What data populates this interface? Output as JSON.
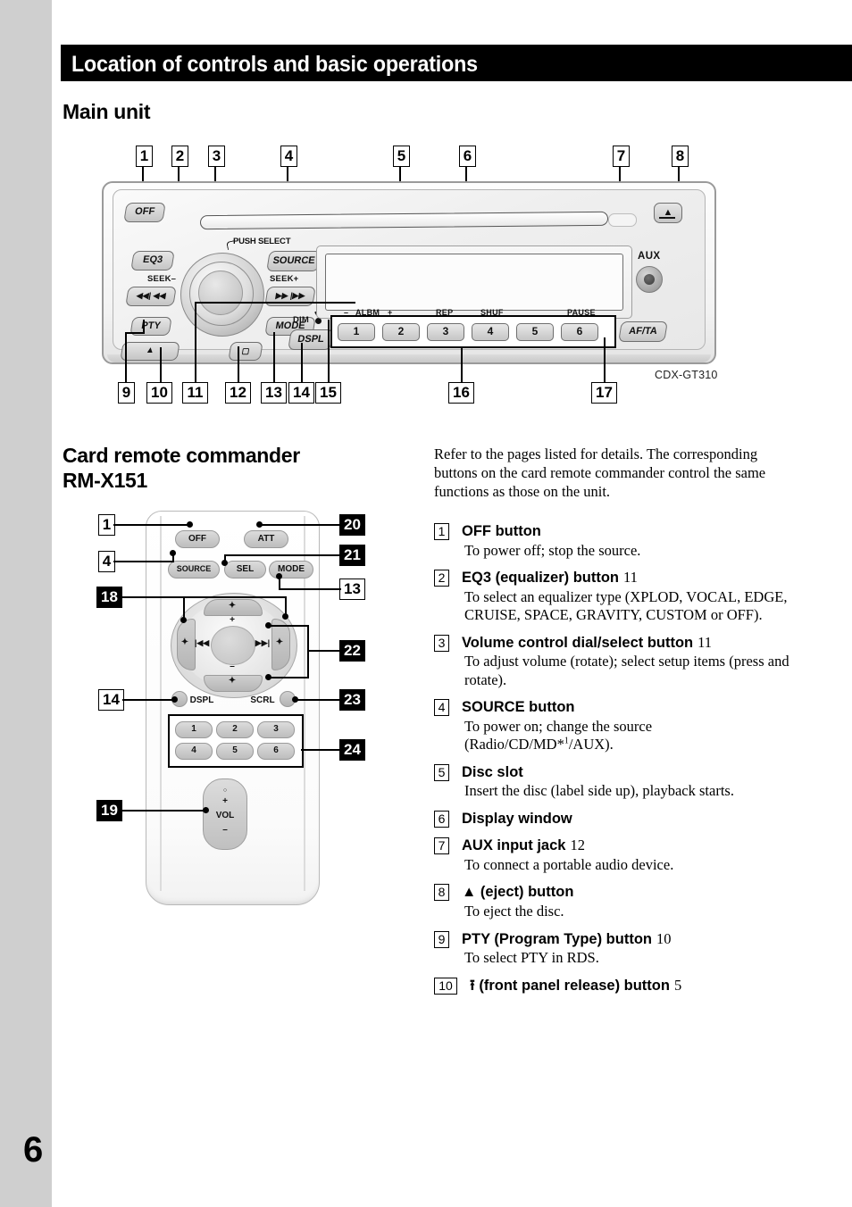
{
  "page": {
    "number": "6"
  },
  "header": {
    "title": "Location of controls and basic operations"
  },
  "sections": {
    "main_unit_title": "Main unit",
    "remote_title": "Card remote commander RM-X151",
    "model_label": "CDX-GT310"
  },
  "main_unit": {
    "callouts_top": [
      "1",
      "2",
      "3",
      "4",
      "5",
      "6",
      "7",
      "8"
    ],
    "callouts_bottom": [
      "9",
      "10",
      "11",
      "12",
      "13",
      "14",
      "15",
      "16",
      "17"
    ],
    "keys": {
      "off": "OFF",
      "eq3": "EQ3",
      "source": "SOURCE",
      "push_select": "PUSH SELECT",
      "seek_minus": "SEEK–",
      "seek_plus": "SEEK+",
      "seek_back_glyph": "◀◀| ◀◀",
      "seek_fwd_glyph": "▶▶ |▶▶",
      "pty": "PTY",
      "eject_front_glyph": "▲",
      "mode": "MODE",
      "dspl": "DSPL",
      "dim": "DIM",
      "eject_top_glyph": "▲",
      "af_ta": "AF/TA",
      "aux": "AUX"
    },
    "preset_labels": {
      "albm_minus": "–",
      "albm": "ALBM",
      "albm_plus": "+",
      "rep": "REP",
      "shuf": "SHUF",
      "pause": "PAUSE"
    },
    "preset_buttons": [
      "1",
      "2",
      "3",
      "4",
      "5",
      "6"
    ]
  },
  "remote": {
    "callouts": [
      {
        "n": "1",
        "inverted": false
      },
      {
        "n": "4",
        "inverted": false
      },
      {
        "n": "18",
        "inverted": true
      },
      {
        "n": "14",
        "inverted": false
      },
      {
        "n": "19",
        "inverted": true
      },
      {
        "n": "20",
        "inverted": true
      },
      {
        "n": "21",
        "inverted": true
      },
      {
        "n": "13",
        "inverted": false
      },
      {
        "n": "22",
        "inverted": true
      },
      {
        "n": "23",
        "inverted": true
      },
      {
        "n": "24",
        "inverted": true
      }
    ],
    "keys": {
      "off": "OFF",
      "att": "ATT",
      "source": "SOURCE",
      "sel": "SEL",
      "mode": "MODE",
      "dspl": "DSPL",
      "scrl": "SCRL",
      "vol": "VOL",
      "vol_plus": "+",
      "vol_minus": "–",
      "vol_mark": "○",
      "up": "✦",
      "down": "✦",
      "left": "✦",
      "right": "✦",
      "plus": "+",
      "minus": "–",
      "prev": "|◀◀",
      "next": "▶▶|"
    },
    "number_buttons": [
      "1",
      "2",
      "3",
      "4",
      "5",
      "6"
    ]
  },
  "intro_text": "Refer to the pages listed for details. The corresponding buttons on the card remote commander control the same functions as those on the unit.",
  "list": [
    {
      "num": "1",
      "title": "OFF button",
      "page": "",
      "desc": "To power off; stop the source."
    },
    {
      "num": "2",
      "title": "EQ3 (equalizer) button",
      "page": "11",
      "desc": "To select an equalizer type (XPLOD, VOCAL, EDGE, CRUISE, SPACE, GRAVITY, CUSTOM or OFF)."
    },
    {
      "num": "3",
      "title": "Volume control dial/select button",
      "page": "11",
      "desc": "To adjust volume (rotate); select setup items (press and rotate)."
    },
    {
      "num": "4",
      "title": "SOURCE button",
      "page": "",
      "desc_html": "To power on; change the source (Radio/CD/MD*<sup>1</sup>/AUX)."
    },
    {
      "num": "5",
      "title": "Disc slot",
      "page": "",
      "desc": "Insert the disc (label side up), playback starts."
    },
    {
      "num": "6",
      "title": "Display window",
      "page": "",
      "desc": ""
    },
    {
      "num": "7",
      "title": "AUX input jack",
      "page": "12",
      "desc": "To connect a portable audio device."
    },
    {
      "num": "8",
      "title": "▲ (eject) button",
      "page": "",
      "desc": "To eject the disc."
    },
    {
      "num": "9",
      "title": "PTY (Program Type) button",
      "page": "10",
      "desc": "To select PTY in RDS."
    },
    {
      "num": "10",
      "title": "⭱ (front panel release) button",
      "page": "5",
      "desc": ""
    }
  ]
}
